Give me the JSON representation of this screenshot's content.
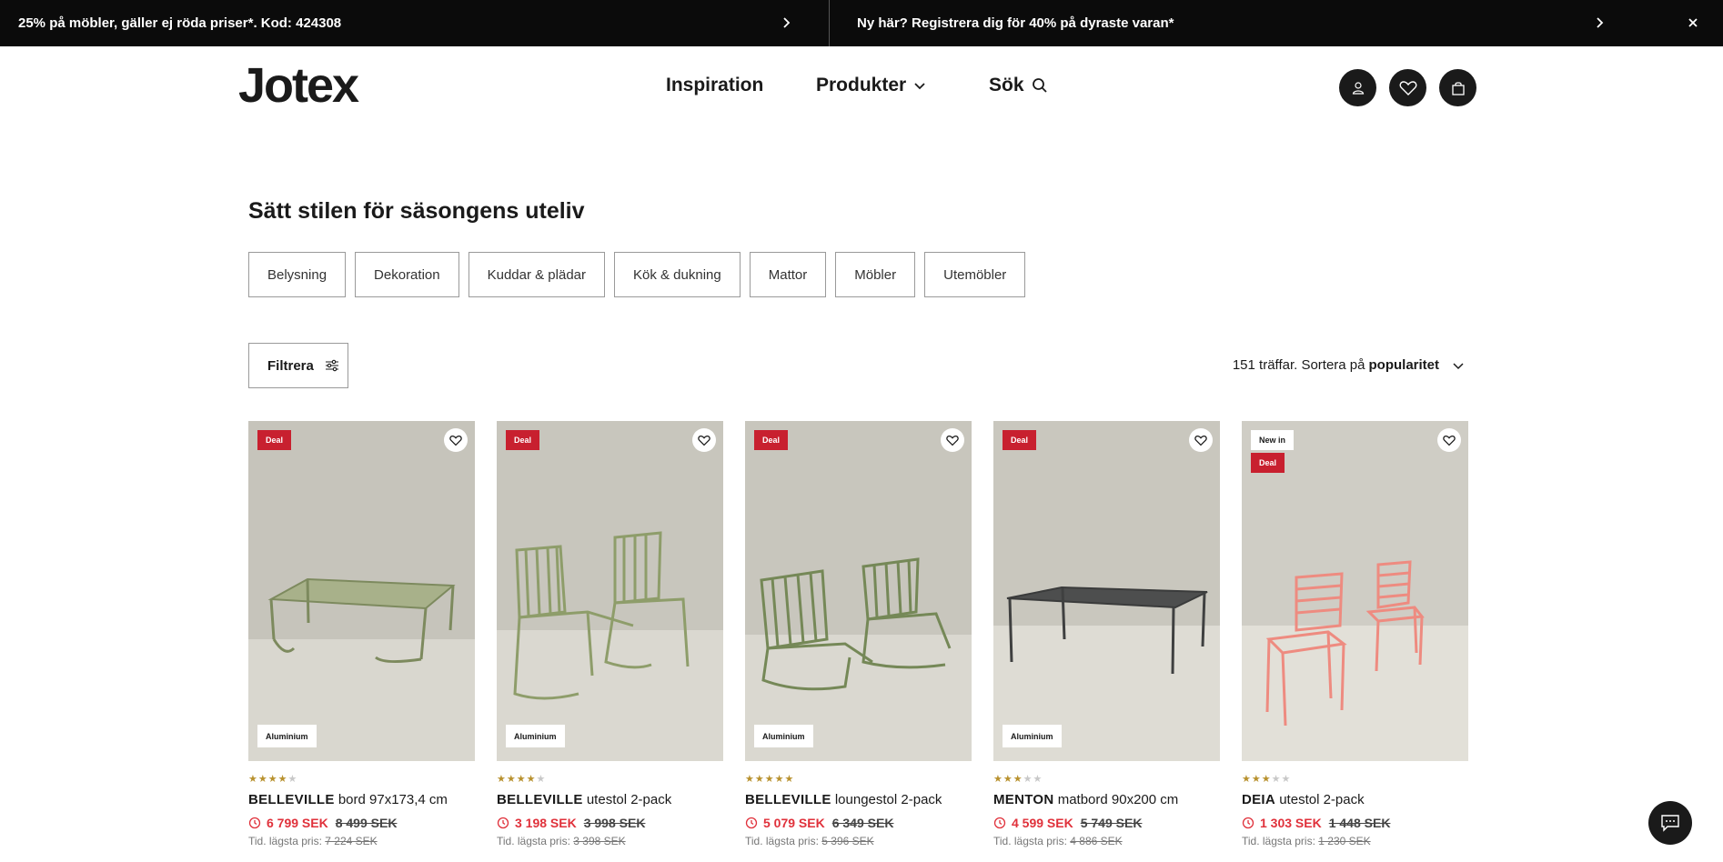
{
  "promo": {
    "left_text": "25% på möbler, gäller ej röda priser*. Kod: 424308",
    "right_text": "Ny här? Registrera dig för 40% på dyraste varan*"
  },
  "header": {
    "logo": "Jotex",
    "nav": {
      "inspiration": "Inspiration",
      "produkter": "Produkter",
      "sok": "Sök"
    }
  },
  "page": {
    "title": "Sätt stilen för säsongens uteliv"
  },
  "categories": [
    "Belysning",
    "Dekoration",
    "Kuddar & plädar",
    "Kök & dukning",
    "Mattor",
    "Möbler",
    "Utemöbler"
  ],
  "filter": {
    "label": "Filtrera"
  },
  "sort": {
    "prefix": "151 träffar. Sortera på",
    "value": "popularitet"
  },
  "products": [
    {
      "brand": "BELLEVILLE",
      "name": "bord 97x173,4 cm",
      "price": "6 799 SEK",
      "old_price": "8 499 SEK",
      "lowest_label": "Tid. lägsta pris:",
      "lowest_value": "7 224 SEK",
      "badges": [
        "Deal"
      ],
      "material": "Aluminium",
      "rating": 4,
      "color": "#8f9a6a"
    },
    {
      "brand": "BELLEVILLE",
      "name": "utestol 2-pack",
      "price": "3 198 SEK",
      "old_price": "3 998 SEK",
      "lowest_label": "Tid. lägsta pris:",
      "lowest_value": "3 398 SEK",
      "badges": [
        "Deal"
      ],
      "material": "Aluminium",
      "rating": 4,
      "color": "#9aa876"
    },
    {
      "brand": "BELLEVILLE",
      "name": "loungestol 2-pack",
      "price": "5 079 SEK",
      "old_price": "6 349 SEK",
      "lowest_label": "Tid. lägsta pris:",
      "lowest_value": "5 396 SEK",
      "badges": [
        "Deal"
      ],
      "material": "Aluminium",
      "rating": 5,
      "color": "#7f9160"
    },
    {
      "brand": "MENTON",
      "name": "matbord 90x200 cm",
      "price": "4 599 SEK",
      "old_price": "5 749 SEK",
      "lowest_label": "Tid. lägsta pris:",
      "lowest_value": "4 886 SEK",
      "badges": [
        "Deal"
      ],
      "material": "Aluminium",
      "rating": 3,
      "color": "#4a4b4b"
    },
    {
      "brand": "DEIA",
      "name": "utestol 2-pack",
      "price": "1 303 SEK",
      "old_price": "1 448 SEK",
      "lowest_label": "Tid. lägsta pris:",
      "lowest_value": "1 230 SEK",
      "badges": [
        "New in",
        "Deal"
      ],
      "material": "",
      "rating": 3,
      "color": "#ef8a7f"
    }
  ],
  "icons": {
    "promo_chevron": "chevron-right-icon",
    "close": "close-icon",
    "account": "user-icon",
    "wishlist": "heart-icon",
    "cart": "bag-icon",
    "chat": "chat-icon"
  },
  "colors": {
    "deal_red": "#c8202f",
    "price_red": "#e0313b",
    "star_gold": "#b8912e",
    "dark": "#1a1a1a"
  }
}
